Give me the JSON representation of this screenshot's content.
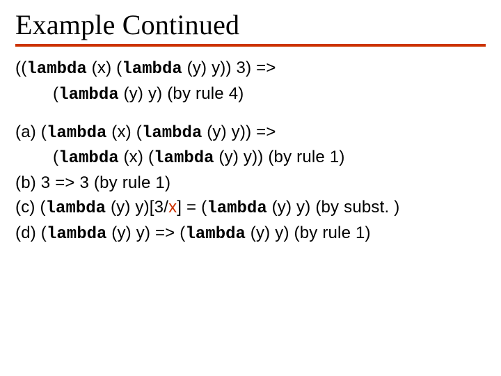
{
  "title": "Example Continued",
  "top": {
    "l1_a": "((",
    "l1_b": "lambda",
    "l1_c": " (x) (",
    "l1_d": "lambda",
    "l1_e": " (y) y)) 3)",
    "l1_f": " => ",
    "l2_a": "(",
    "l2_b": "lambda",
    "l2_c": " (y) y)",
    "l2_d": "  (by rule 4)"
  },
  "a": {
    "l1_a": "(a) (",
    "l1_b": "lambda",
    "l1_c": " (x) (",
    "l1_d": "lambda",
    "l1_e": " (y) y))",
    "l1_f": " =>",
    "l2_a": "(",
    "l2_b": "lambda",
    "l2_c": " (x) (",
    "l2_d": "lambda",
    "l2_e": " (y) y))",
    "l2_f": "  (by rule 1)"
  },
  "b": {
    "l1_a": "(b) 3 => 3 (by rule 1)"
  },
  "c": {
    "l1_a": "(c) (",
    "l1_b": "lambda",
    "l1_c": " (y) y)",
    "l1_d": "[3/",
    "l1_e": "x",
    "l1_f": "] = (",
    "l1_g": "lambda",
    "l1_h": " (y) y)",
    "l1_i": "  (by subst. )"
  },
  "d": {
    "l1_a": "(d) (",
    "l1_b": "lambda",
    "l1_c": " (y) y)",
    "l1_d": " => (",
    "l1_e": "lambda",
    "l1_f": " (y) y)",
    "l1_g": " (by rule 1)"
  }
}
